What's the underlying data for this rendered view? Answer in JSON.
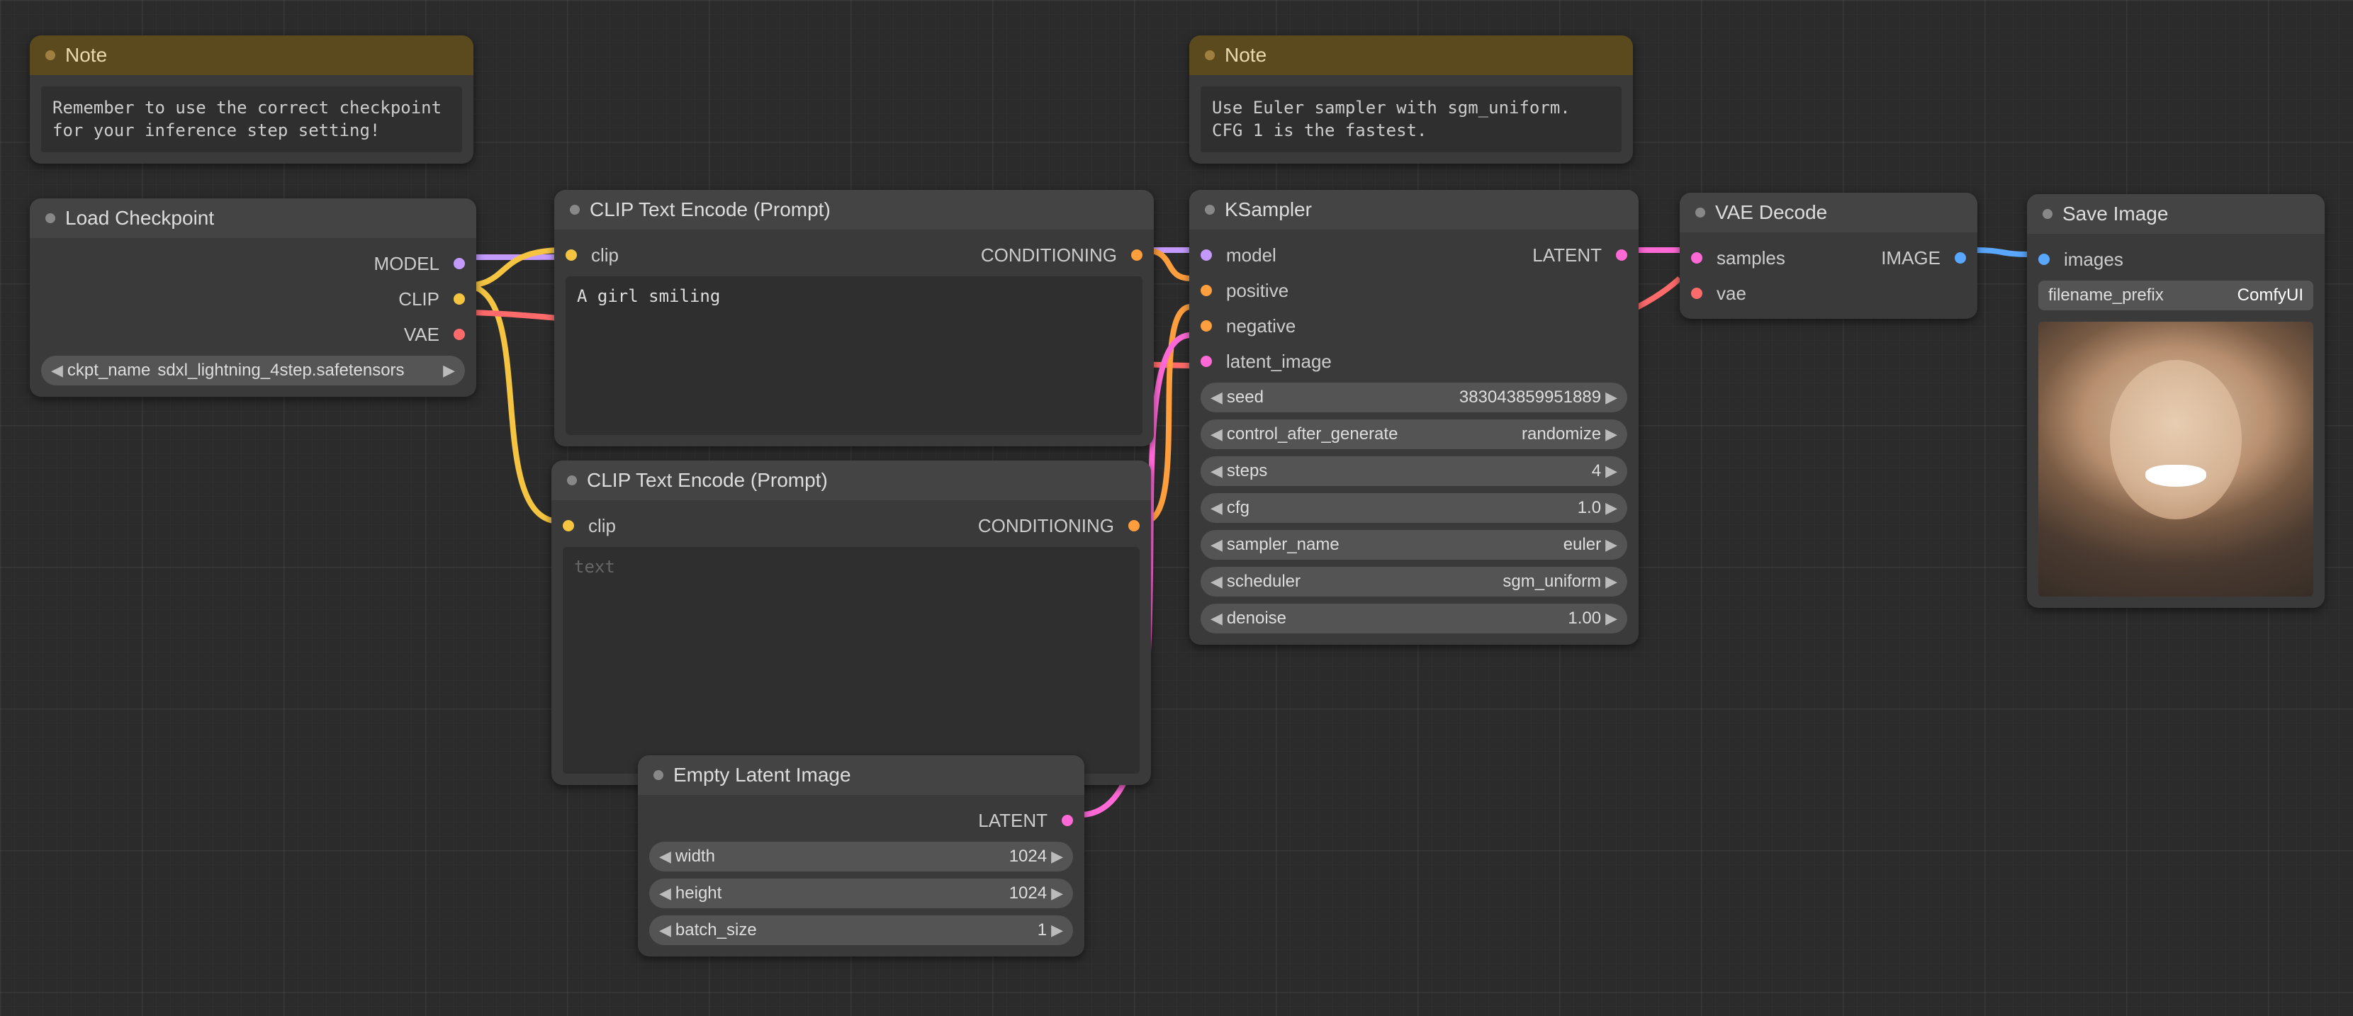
{
  "note1": {
    "title": "Note",
    "text": "Remember to use the correct checkpoint for your inference step setting!"
  },
  "note2": {
    "title": "Note",
    "text": "Use Euler sampler with sgm_uniform.\nCFG 1 is the fastest."
  },
  "load_ckpt": {
    "title": "Load Checkpoint",
    "outputs": {
      "model": "MODEL",
      "clip": "CLIP",
      "vae": "VAE"
    },
    "widget_label": "ckpt_name",
    "widget_value": "sdxl_lightning_4step.safetensors"
  },
  "clip_pos": {
    "title": "CLIP Text Encode (Prompt)",
    "input": "clip",
    "output": "CONDITIONING",
    "text": "A girl smiling"
  },
  "clip_neg": {
    "title": "CLIP Text Encode (Prompt)",
    "input": "clip",
    "output": "CONDITIONING",
    "placeholder": "text"
  },
  "empty_latent": {
    "title": "Empty Latent Image",
    "output": "LATENT",
    "width": {
      "label": "width",
      "value": "1024"
    },
    "height": {
      "label": "height",
      "value": "1024"
    },
    "batch": {
      "label": "batch_size",
      "value": "1"
    }
  },
  "ksampler": {
    "title": "KSampler",
    "inputs": {
      "model": "model",
      "positive": "positive",
      "negative": "negative",
      "latent_image": "latent_image"
    },
    "output": "LATENT",
    "seed": {
      "label": "seed",
      "value": "383043859951889"
    },
    "control": {
      "label": "control_after_generate",
      "value": "randomize"
    },
    "steps": {
      "label": "steps",
      "value": "4"
    },
    "cfg": {
      "label": "cfg",
      "value": "1.0"
    },
    "sampler": {
      "label": "sampler_name",
      "value": "euler"
    },
    "scheduler": {
      "label": "scheduler",
      "value": "sgm_uniform"
    },
    "denoise": {
      "label": "denoise",
      "value": "1.00"
    }
  },
  "vae_decode": {
    "title": "VAE Decode",
    "inputs": {
      "samples": "samples",
      "vae": "vae"
    },
    "output": "IMAGE"
  },
  "save_image": {
    "title": "Save Image",
    "input": "images",
    "prefix_label": "filename_prefix",
    "prefix_value": "ComfyUI"
  }
}
